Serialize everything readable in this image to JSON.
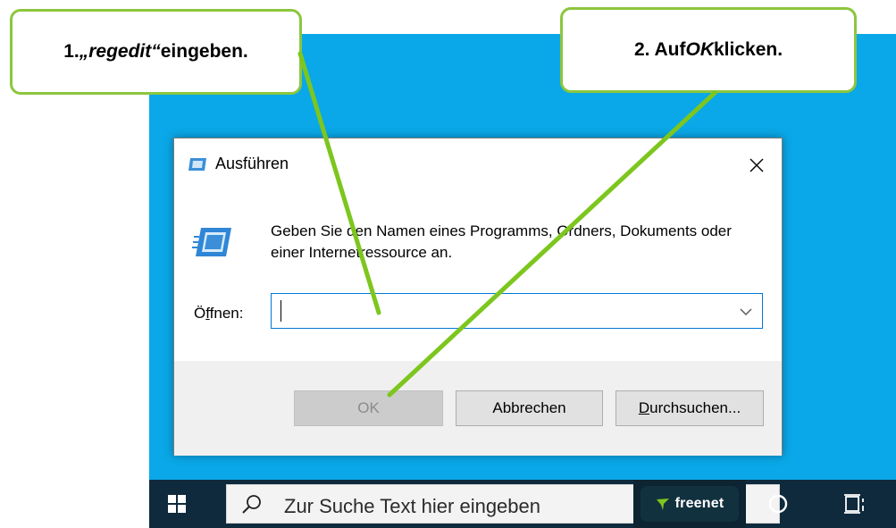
{
  "callouts": {
    "step1": {
      "prefix": "1. ",
      "italic": "„regedit“",
      "suffix": " eingeben."
    },
    "step2": {
      "prefix": "2. Auf ",
      "italic": "OK",
      "suffix": " klicken."
    }
  },
  "dialog": {
    "title": "Ausführen",
    "close_icon": "close-icon",
    "description": "Geben Sie den Namen eines Programms, Ordners, Dokuments oder einer Internetressource an.",
    "open_label_accel": "f",
    "open_label_pre": "Ö",
    "open_label_post": "fnen:",
    "input_value": "",
    "buttons": {
      "ok": "OK",
      "cancel": "Abbrechen",
      "browse_accel": "D",
      "browse_rest": "urchsuchen..."
    }
  },
  "taskbar": {
    "start_icon": "windows-logo-icon",
    "search_placeholder": "Zur Suche Text hier eingeben",
    "freenet_label": "freenet",
    "cortana_icon": "cortana-circle-icon",
    "taskview_icon": "task-view-icon"
  },
  "colors": {
    "desktop": "#0aa8e8",
    "taskbar": "#0f2a3d",
    "callout_border": "#8cc63e",
    "arrow": "#7dc61e",
    "input_focus": "#0078d7"
  }
}
